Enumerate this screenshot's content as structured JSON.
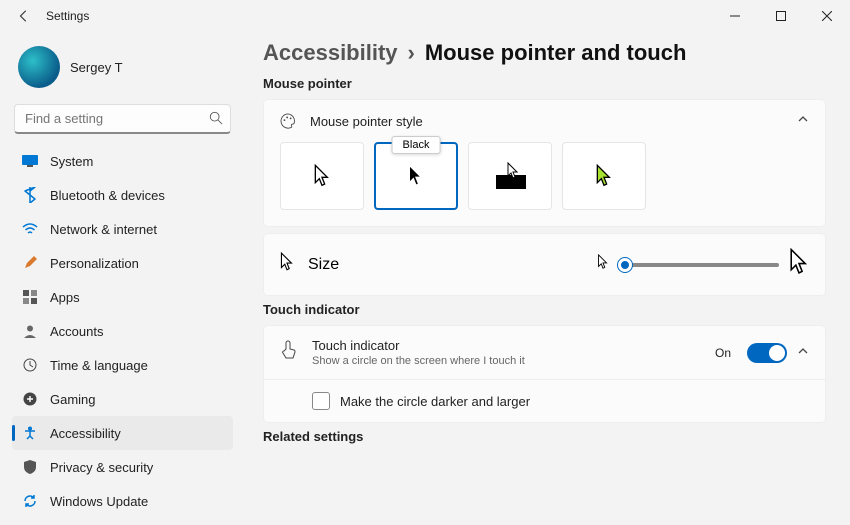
{
  "window": {
    "title": "Settings"
  },
  "user": {
    "name": "Sergey T"
  },
  "search": {
    "placeholder": "Find a setting"
  },
  "nav": [
    {
      "label": "System"
    },
    {
      "label": "Bluetooth & devices"
    },
    {
      "label": "Network & internet"
    },
    {
      "label": "Personalization"
    },
    {
      "label": "Apps"
    },
    {
      "label": "Accounts"
    },
    {
      "label": "Time & language"
    },
    {
      "label": "Gaming"
    },
    {
      "label": "Accessibility"
    },
    {
      "label": "Privacy & security"
    },
    {
      "label": "Windows Update"
    }
  ],
  "breadcrumb": {
    "category": "Accessibility",
    "sep": "›",
    "page": "Mouse pointer and touch"
  },
  "sections": {
    "mouse_pointer": "Mouse pointer",
    "touch_indicator": "Touch indicator",
    "related": "Related settings"
  },
  "pointer_style": {
    "label": "Mouse pointer style",
    "selected_tooltip": "Black"
  },
  "size": {
    "label": "Size"
  },
  "touch": {
    "title": "Touch indicator",
    "subtitle": "Show a circle on the screen where I touch it",
    "state": "On",
    "option": "Make the circle darker and larger"
  }
}
